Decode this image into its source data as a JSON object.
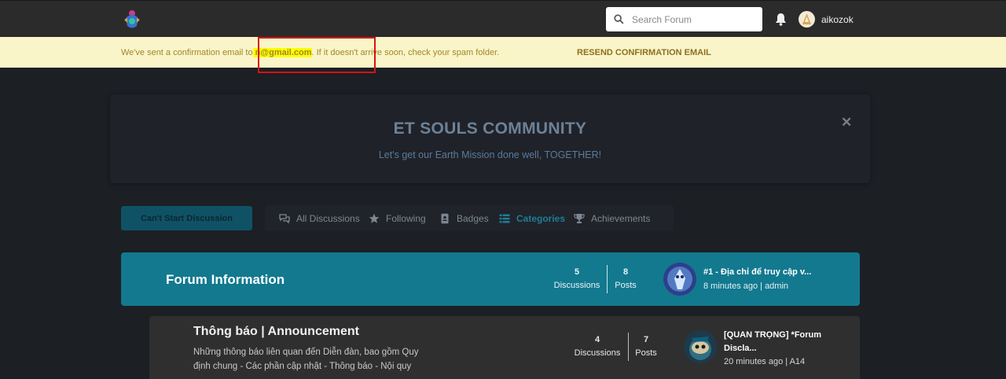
{
  "header": {
    "search_placeholder": "Search Forum",
    "username": "aikozok",
    "icons": [
      "logo-icon",
      "search-icon",
      "bell-icon",
      "avatar"
    ]
  },
  "alert": {
    "text_before": "We've sent a confirmation email to",
    "email": "n@gmail.com",
    "text_after": ". If it doesn't arrive soon, check your spam folder.",
    "resend_label": "RESEND CONFIRMATION EMAIL"
  },
  "hero": {
    "title": "ET SOULS COMMUNITY",
    "subtitle": "Let's get our Earth Mission done well, TOGETHER!",
    "close_label": "✕"
  },
  "toolbar": {
    "start_button": "Can't Start Discussion",
    "nav": [
      {
        "label": "All Discussions",
        "icon": "comments-icon"
      },
      {
        "label": "Following",
        "icon": "star-icon"
      },
      {
        "label": "Badges",
        "icon": "badge-icon"
      },
      {
        "label": "Categories",
        "icon": "list-icon",
        "active": true
      },
      {
        "label": "Achievements",
        "icon": "trophy-icon"
      }
    ]
  },
  "categories": [
    {
      "title": "Forum Information",
      "discussions": "5",
      "discussions_label": "Discussions",
      "posts": "8",
      "posts_label": "Posts",
      "last_title": "#1 - Địa chỉ để truy cập v...",
      "last_meta": "8 minutes ago | admin"
    },
    {
      "title": "Thông báo | Announcement",
      "description": "Những thông báo liên quan đến Diễn đàn, bao gồm Quy định chung - Các phần cập nhật - Thông báo - Nội quy",
      "discussions": "4",
      "discussions_label": "Discussions",
      "posts": "7",
      "posts_label": "Posts",
      "last_title": "[QUAN TRỌNG] *Forum Discla...",
      "last_meta": "20 minutes ago | A14"
    }
  ],
  "colors": {
    "header_bg": "#2b2b2b",
    "alert_bg": "#faf5c8",
    "primary": "#12798f",
    "highlight": "#ffff00",
    "annotation_red": "#d81313"
  }
}
